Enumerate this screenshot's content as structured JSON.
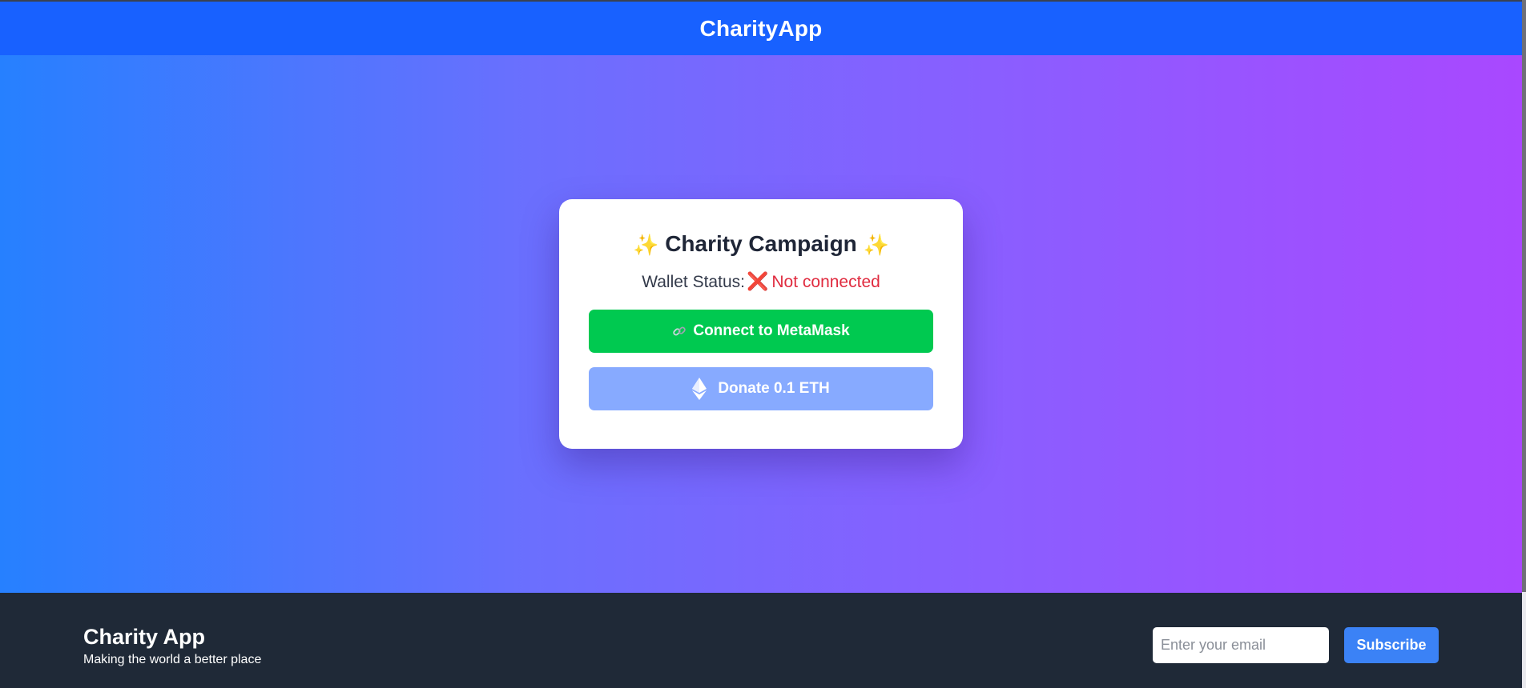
{
  "header": {
    "title": "CharityApp"
  },
  "card": {
    "title": "Charity Campaign",
    "sparkle": "✨",
    "status_label": "Wallet Status:",
    "status_icon": "❌",
    "status_value": "Not connected",
    "connect_label": "Connect to MetaMask",
    "donate_label": "Donate 0.1 ETH"
  },
  "footer": {
    "brand": "Charity App",
    "tagline": "Making the world a better place",
    "email_placeholder": "Enter your email",
    "subscribe_label": "Subscribe"
  },
  "icons": {
    "title_left": "sparkles-icon",
    "title_right": "sparkles-icon",
    "status": "cross-mark-icon",
    "connect": "link-icon",
    "donate": "ethereum-icon"
  },
  "colors": {
    "header_bg": "#1861ff",
    "gradient_start": "#2680ff",
    "gradient_end": "#a948ff",
    "connect_bg": "#00c950",
    "donate_bg": "#87aaff",
    "status_error": "#e02b3f",
    "footer_bg": "#1f2937",
    "subscribe_bg": "#3b82f6"
  }
}
